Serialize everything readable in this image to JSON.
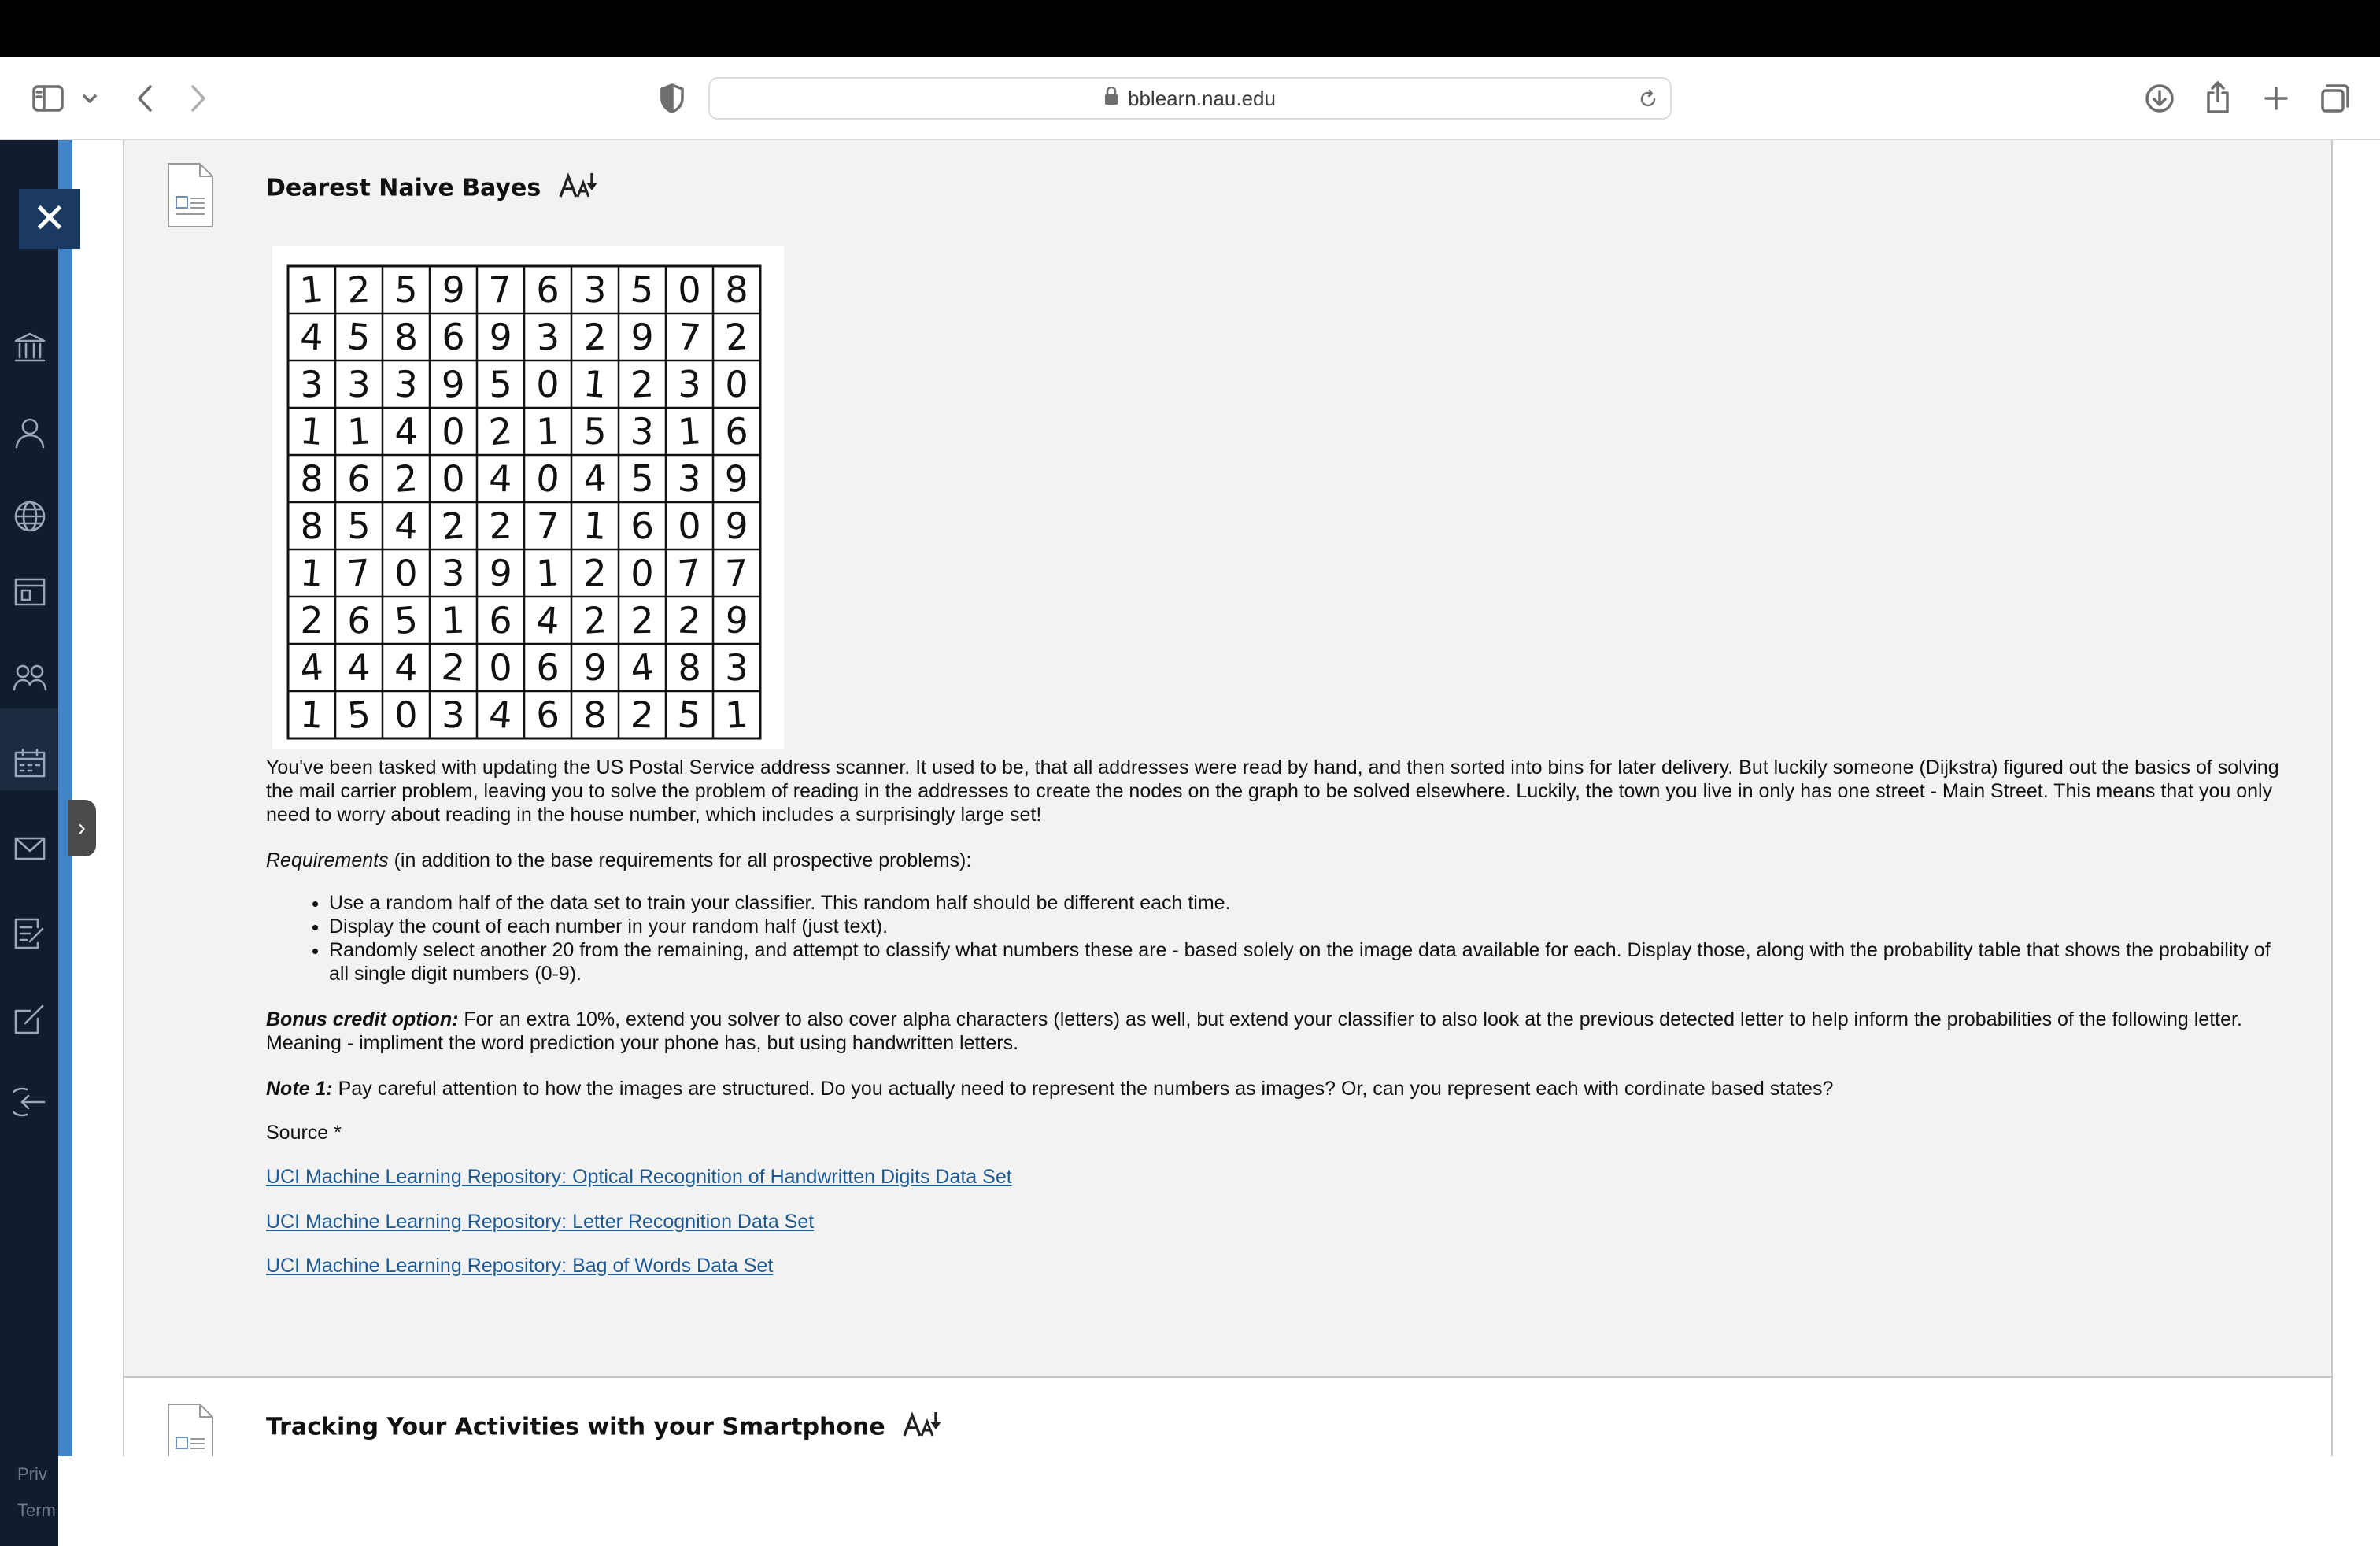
{
  "browser": {
    "url": "bblearn.nau.edu"
  },
  "sidebar": {
    "close_symbol": "✕",
    "expand_symbol": "›",
    "icons": [
      "institution-icon",
      "profile-icon",
      "globe-icon",
      "courses-icon",
      "groups-icon",
      "calendar-icon",
      "messages-icon",
      "grades-icon",
      "tools-icon",
      "sign-out-icon"
    ],
    "footer_privacy": "Priv",
    "footer_terms": "Term"
  },
  "item1": {
    "title": "Dearest Naive Bayes",
    "digit_grid": [
      [
        "1",
        "2",
        "5",
        "9",
        "7",
        "6",
        "3",
        "5",
        "0",
        "8"
      ],
      [
        "4",
        "5",
        "8",
        "6",
        "9",
        "3",
        "2",
        "9",
        "7",
        "2"
      ],
      [
        "3",
        "3",
        "3",
        "9",
        "5",
        "0",
        "1",
        "2",
        "3",
        "0"
      ],
      [
        "1",
        "1",
        "4",
        "0",
        "2",
        "1",
        "5",
        "3",
        "1",
        "6"
      ],
      [
        "8",
        "6",
        "2",
        "0",
        "4",
        "0",
        "4",
        "5",
        "3",
        "9"
      ],
      [
        "8",
        "5",
        "4",
        "2",
        "2",
        "7",
        "1",
        "6",
        "0",
        "9"
      ],
      [
        "1",
        "7",
        "0",
        "3",
        "9",
        "1",
        "2",
        "0",
        "7",
        "7"
      ],
      [
        "2",
        "6",
        "5",
        "1",
        "6",
        "4",
        "2",
        "2",
        "2",
        "9"
      ],
      [
        "4",
        "4",
        "4",
        "2",
        "0",
        "6",
        "9",
        "4",
        "8",
        "3"
      ],
      [
        "1",
        "5",
        "0",
        "3",
        "4",
        "6",
        "8",
        "2",
        "5",
        "1"
      ]
    ],
    "intro": "You've been tasked with updating the US Postal Service address scanner.  It used to be, that all addresses were read by hand, and then sorted into bins for later delivery.  But luckily someone (Dijkstra) figured out the basics of solving the mail carrier problem, leaving you to solve the problem of reading in the addresses to create the nodes on the graph to be solved elsewhere.  Luckily, the town you live in only has one street - Main Street.  This means that you only need to worry about reading in the house number, which includes a surprisingly large set!",
    "requirements_label": "Requirements",
    "requirements_suffix": " (in addition to the base requirements for all prospective problems):",
    "requirements": [
      "Use a random half of the data set to train your classifier.  This random half should be different each time.",
      "Display the count of each number in your random half (just text).",
      "Randomly select another 20 from the remaining, and attempt to classify what numbers these are - based solely on the image data available for each.  Display those, along with the probability table that shows the probability of all single digit numbers (0-9)."
    ],
    "bonus_label": "Bonus credit option:",
    "bonus_text": " For an extra 10%, extend you solver to also cover alpha characters (letters) as well, but extend your classifier to also look at the previous detected letter to help inform the probabilities of the following letter.  Meaning - impliment the word prediction your phone has, but using handwritten letters.",
    "note_label": "Note 1:",
    "note_text": " Pay careful attention to how the images are structured.  Do you actually need to represent the numbers as images?  Or, can you represent each with cordinate based states?",
    "source_label": "Source *",
    "links": [
      "UCI Machine Learning Repository: Optical Recognition of Handwritten Digits Data Set",
      "UCI Machine Learning Repository: Letter Recognition Data Set",
      "UCI Machine Learning Repository: Bag of Words Data Set"
    ]
  },
  "item2": {
    "title": "Tracking Your Activities with your Smartphone"
  }
}
